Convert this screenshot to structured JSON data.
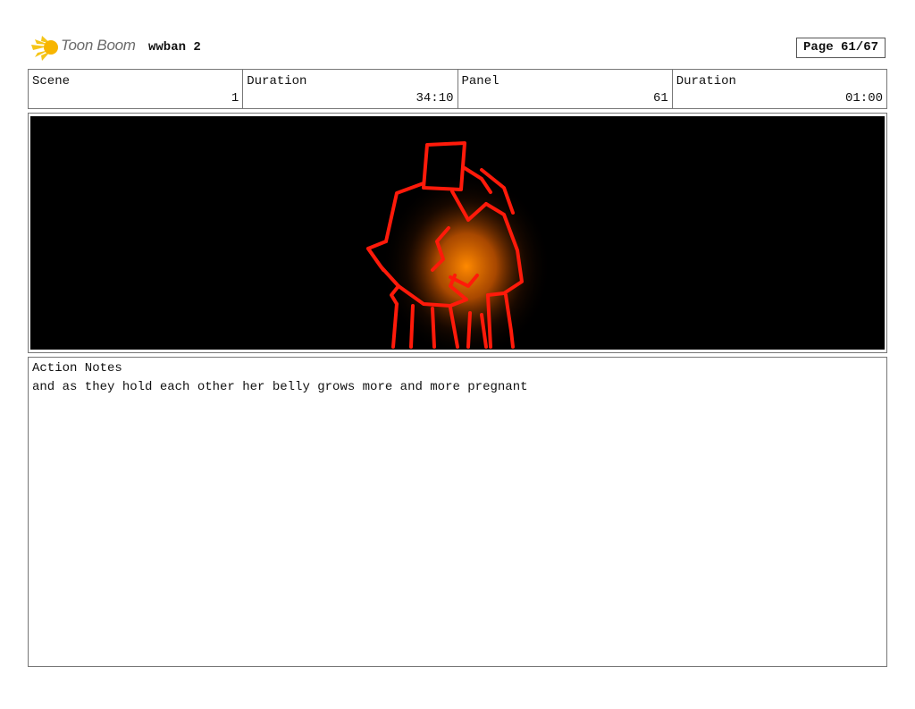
{
  "header": {
    "logo_text": "Toon Boom",
    "project_title": "wwban 2",
    "page_label": "Page 61/67"
  },
  "info": {
    "scene_label": "Scene",
    "scene_value": "1",
    "duration_label": "Duration",
    "duration_value": "34:10",
    "panel_label": "Panel",
    "panel_value": "61",
    "panel_duration_label": "Duration",
    "panel_duration_value": "01:00"
  },
  "panel": {
    "background_color": "#000000",
    "line_color": "#ff1a0a",
    "glow_color": "#ff8a00"
  },
  "notes": {
    "label": "Action Notes",
    "text": "and as they hold each other her belly grows more and more pregnant"
  }
}
